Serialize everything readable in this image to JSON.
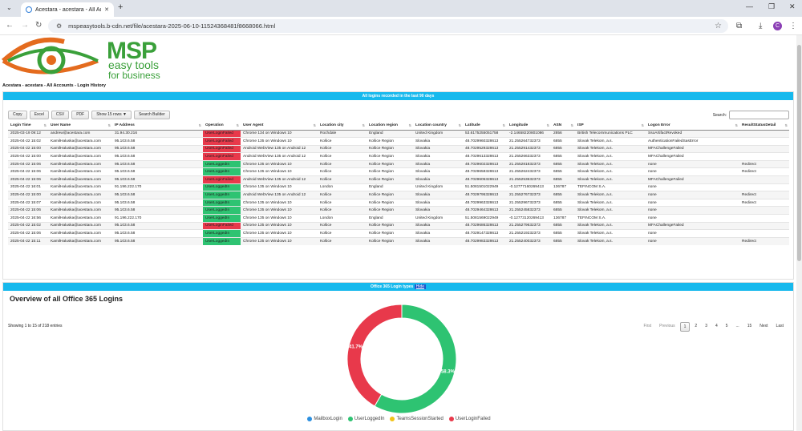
{
  "browser": {
    "tab_title": "Acestara - acestara - All Accoun",
    "url": "mspeasytools.b-cdn.net/file/acestara-2025-06-10-11524368481f8668066.html",
    "profile_initial": "C"
  },
  "logo": {
    "name": "MSP",
    "tagline1": "easy tools",
    "tagline2": "for business"
  },
  "breadcrumb": "Acestara - acestara - All Accounts - Login History",
  "table_panel": {
    "header": "All logins recorded in the last 90 days",
    "buttons": [
      "Copy",
      "Excel",
      "CSV",
      "PDF",
      "Show 15 rows",
      "Search Builder"
    ],
    "search_label": "Search:",
    "search_value": "",
    "columns": [
      "Login Time",
      "User Name",
      "IP Address",
      "Operation",
      "User Agent",
      "Location city",
      "Location region",
      "Location country",
      "Latitude",
      "Longitude",
      "ASN",
      "ISP",
      "Logon Error",
      "ResultStatusDetail"
    ],
    "rows": [
      [
        "2025-03-19 09:12",
        "andrew@acestara.com",
        "31.94.30.216",
        "UserLoginFailed",
        "Chrome 134 on Windows 10",
        "Rochdale",
        "England",
        "United Kingdom",
        "53.6175255051758",
        "-2.14658220801086",
        "2856",
        "British Telecommunications PLC",
        "SsoArtifactRevoked",
        ""
      ],
      [
        "2025-04-22 15:02",
        "KamilHaluska@acestara.com",
        "95.103.6.58",
        "UserLoginFailed",
        "Chrome 135 on Windows 10",
        "Košice",
        "Košice Region",
        "Slovakia",
        "48.7029960328613",
        "21.255264732373",
        "6855",
        "Slovak Telekom, a.s.",
        "AuthenticationFailedSasError",
        ""
      ],
      [
        "2025-04-22 15:00",
        "KamilHaluska@acestara.com",
        "95.103.6.58",
        "UserLoginFailed",
        "Android WebView 135 on Android 12",
        "Košice",
        "Košice Region",
        "Slovakia",
        "48.7029529328613",
        "21.255291432373",
        "6855",
        "Slovak Telekom, a.s.",
        "MFAChallengeFailed",
        ""
      ],
      [
        "2025-04-22 15:00",
        "KamilHaluska@acestara.com",
        "95.103.6.58",
        "UserLoginFailed",
        "Android WebView 135 on Android 12",
        "Košice",
        "Košice Region",
        "Slovakia",
        "48.7029613328613",
        "21.255266332373",
        "6855",
        "Slovak Telekom, a.s.",
        "MFAChallengeFailed",
        ""
      ],
      [
        "2025-04-22 15:06",
        "KamilHaluska@acestara.com",
        "95.103.6.58",
        "UserLoggedIn",
        "Chrome 135 on Windows 10",
        "Košice",
        "Košice Region",
        "Slovakia",
        "48.7029602328613",
        "21.255281832373",
        "6855",
        "Slovak Telekom, a.s.",
        "none",
        "Redirect"
      ],
      [
        "2025-04-22 15:06",
        "KamilHaluska@acestara.com",
        "95.103.6.58",
        "UserLoggedIn",
        "Chrome 135 on Windows 10",
        "Košice",
        "Košice Region",
        "Slovakia",
        "48.7029658328613",
        "21.255262432373",
        "6855",
        "Slovak Telekom, a.s.",
        "none",
        "Redirect"
      ],
      [
        "2025-04-22 15:06",
        "KamilHaluska@acestara.com",
        "95.103.6.58",
        "UserLoginFailed",
        "Android WebView 135 on Android 12",
        "Košice",
        "Košice Region",
        "Slovakia",
        "48.7029605328613",
        "21.255253632373",
        "6855",
        "Slovak Telekom, a.s.",
        "MFAChallengeFailed",
        ""
      ],
      [
        "2025-04-22 16:01",
        "KamilHaluska@acestara.com",
        "91.196.222.170",
        "UserLoggedIn",
        "Chrome 135 on Windows 10",
        "London",
        "England",
        "United Kingdom",
        "51.5081501022949",
        "-0.12777160269413",
        "136787",
        "TEFINCOM S.A.",
        "none",
        ""
      ],
      [
        "2025-04-22 15:00",
        "KamilHaluska@acestara.com",
        "95.103.6.58",
        "UserLoggedIn",
        "Android WebView 135 on Android 12",
        "Košice",
        "Košice Region",
        "Slovakia",
        "48.7029795328613",
        "21.255276732373",
        "6855",
        "Slovak Telekom, a.s.",
        "none",
        "Redirect"
      ],
      [
        "2025-04-22 15:07",
        "KamilHaluska@acestara.com",
        "95.103.6.58",
        "UserLoggedIn",
        "Chrome 135 on Windows 10",
        "Košice",
        "Košice Region",
        "Slovakia",
        "48.7029963328613",
        "21.255296732373",
        "6855",
        "Slovak Telekom, a.s.",
        "none",
        "Redirect"
      ],
      [
        "2025-04-22 15:06",
        "KamilHaluska@acestara.com",
        "95.103.6.58",
        "UserLoggedIn",
        "Chrome 135 on Windows 10",
        "Košice",
        "Košice Region",
        "Slovakia",
        "48.7029464328613",
        "21.255245832373",
        "6855",
        "Slovak Telekom, a.s.",
        "none",
        ""
      ],
      [
        "2025-04-22 16:56",
        "KamilHaluska@acestara.com",
        "91.196.222.170",
        "UserLoggedIn",
        "Chrome 135 on Windows 10",
        "London",
        "England",
        "United Kingdom",
        "51.5081569022949",
        "-0.12773120269413",
        "136787",
        "TEFINCOM S.A.",
        "none",
        ""
      ],
      [
        "2025-04-22 15:02",
        "KamilHaluska@acestara.com",
        "95.103.6.58",
        "UserLoginFailed",
        "Chrome 135 on Windows 10",
        "Košice",
        "Košice Region",
        "Slovakia",
        "48.7029686328613",
        "21.255279632373",
        "6855",
        "Slovak Telekom, a.s.",
        "MFAChallengeFailed",
        ""
      ],
      [
        "2025-04-22 15:06",
        "KamilHaluska@acestara.com",
        "95.103.6.58",
        "UserLoggedIn",
        "Chrome 135 on Windows 10",
        "Košice",
        "Košice Region",
        "Slovakia",
        "48.7029147328613",
        "21.255219232373",
        "6855",
        "Slovak Telekom, a.s.",
        "none",
        ""
      ],
      [
        "2025-04-22 15:11",
        "KamilHaluska@acestara.com",
        "95.103.6.58",
        "UserLoggedIn",
        "Chrome 135 on Windows 10",
        "Košice",
        "Košice Region",
        "Slovakia",
        "48.7029983328613",
        "21.255240032373",
        "6855",
        "Slovak Telekom, a.s.",
        "none",
        "Redirect"
      ]
    ],
    "info": "Showing 1 to 15 of 218 entries",
    "pager": [
      "First",
      "Previous",
      "1",
      "2",
      "3",
      "4",
      "5",
      "...",
      "15",
      "Next",
      "Last"
    ]
  },
  "chart_panel": {
    "header": "Office 365 Login types",
    "hide_link": "Hide",
    "title": "Overview of all Office 365 Logins"
  },
  "colors": {
    "accent": "#17b9ed",
    "failed": "#e8394b",
    "ok": "#2ec372",
    "mailbox": "#2b8fe0",
    "teams": "#f2c318"
  },
  "chart_data": {
    "type": "pie",
    "style": "donut",
    "categories": [
      "MailboxLogin",
      "UserLoggedIn",
      "TeamsSessionStarted",
      "UserLoginFailed"
    ],
    "values": [
      0,
      58.3,
      0,
      41.7
    ],
    "labels": [
      "",
      "58.3%",
      "",
      "41.7%"
    ],
    "colors": [
      "#2b8fe0",
      "#2ec372",
      "#f2c318",
      "#e8394b"
    ],
    "legend": "bottom"
  }
}
